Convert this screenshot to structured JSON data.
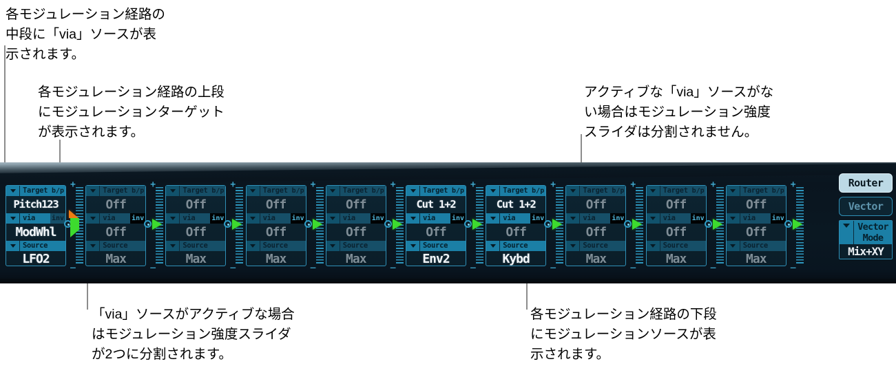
{
  "callouts": [
    {
      "id": "via-middle-row",
      "text": "各モジュレーション経路の\n中段に「via」ソースが表\n示されます。"
    },
    {
      "id": "target-top-row",
      "text": "各モジュレーション経路の上段\nにモジュレーションターゲット\nが表示されます。"
    },
    {
      "id": "no-via-no-split",
      "text": "アクティブな「via」ソースがな\nい場合はモジュレーション強度\nスライダは分割されません。"
    },
    {
      "id": "via-active-split",
      "text": "「via」ソースがアクティブな場合\nはモジュレーション強度スライダ\nが2つに分割されます。"
    },
    {
      "id": "source-bottom-row",
      "text": "各モジュレーション経路の下段\nにモジュレーションソースが表\n示されます。"
    }
  ],
  "panel": {
    "row_labels": {
      "target": "Target",
      "bp": "b/p",
      "via": "via",
      "inv": "inv",
      "source": "Source"
    },
    "slots": [
      {
        "index": 1,
        "target": "Pitch123",
        "via": "ModWhl",
        "source": "LFO2",
        "active": true,
        "split": true,
        "inv_on": false
      },
      {
        "index": 2,
        "target": "Off",
        "via": "Off",
        "source": "Max",
        "active": false,
        "split": false,
        "inv_on": true
      },
      {
        "index": 3,
        "target": "Off",
        "via": "Off",
        "source": "Max",
        "active": false,
        "split": false,
        "inv_on": true
      },
      {
        "index": 4,
        "target": "Off",
        "via": "Off",
        "source": "Max",
        "active": false,
        "split": false,
        "inv_on": true
      },
      {
        "index": 5,
        "target": "Off",
        "via": "Off",
        "source": "Max",
        "active": false,
        "split": false,
        "inv_on": true
      },
      {
        "index": 6,
        "target": "Cut 1+2",
        "via": "Off",
        "source": "Env2",
        "active": true,
        "split": false,
        "inv_on": true
      },
      {
        "index": 7,
        "target": "Cut 1+2",
        "via": "Off",
        "source": "Kybd",
        "active": true,
        "split": false,
        "inv_on": true
      },
      {
        "index": 8,
        "target": "Off",
        "via": "Off",
        "source": "Max",
        "active": false,
        "split": false,
        "inv_on": true
      },
      {
        "index": 9,
        "target": "Off",
        "via": "Off",
        "source": "Max",
        "active": false,
        "split": false,
        "inv_on": true
      },
      {
        "index": 10,
        "target": "Off",
        "via": "Off",
        "source": "Max",
        "active": false,
        "split": false,
        "inv_on": true
      }
    ],
    "slider": {
      "plus": "+",
      "minus": "_"
    }
  },
  "side": {
    "router_label": "Router",
    "vector_label": "Vector",
    "vector_mode_label_line1": "Vector",
    "vector_mode_label_line2": "Mode",
    "vector_mode_value": "Mix+XY"
  },
  "colors": {
    "panel_bg": "#0a1822",
    "accent_blue": "#1b7fa6",
    "outline_blue": "#2f91b8",
    "slider_green": "#3ddb2e",
    "slider_orange": "#f07c12",
    "button_active": "#bcd9e5",
    "text_white": "#e9eef2",
    "text_muted": "#7f8d96",
    "callout_text": "#000000",
    "leader_line": "#8c8c8c"
  }
}
